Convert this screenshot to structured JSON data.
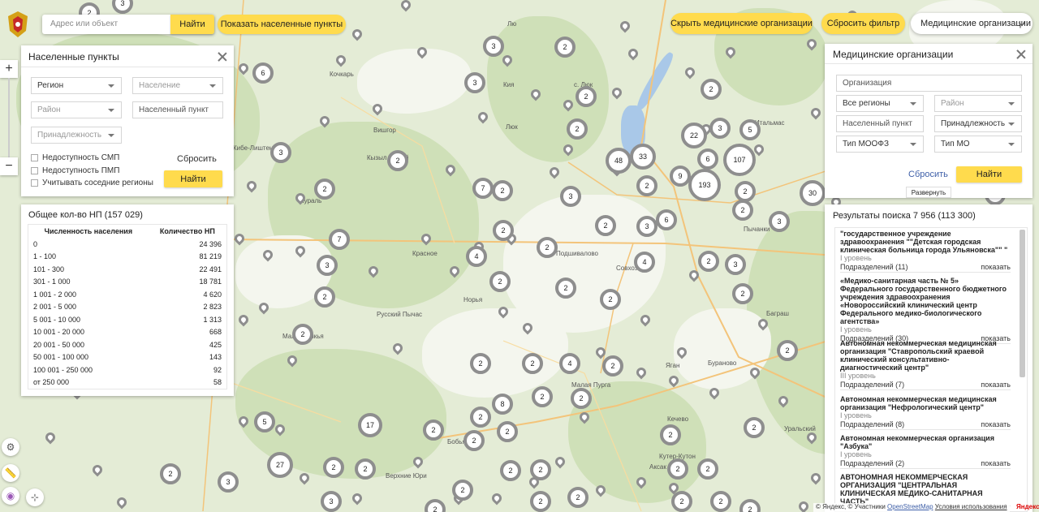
{
  "search": {
    "placeholder": "Адрес или объект",
    "find_label": "Найти",
    "show_settlements_label": "Показать населенные пункты"
  },
  "top_right": {
    "hide_orgs_label": "Скрыть медицинские организации",
    "reset_filter_label": "Сбросить фильтр",
    "layer_select_label": "Медицинские организации"
  },
  "settlements_panel": {
    "title": "Населенные пункты",
    "region": "Регион",
    "population": "Население",
    "district": "Район",
    "settlement": "Населенный пункт",
    "affiliation": "Принадлежность",
    "cb_smp": "Недоступность СМП",
    "cb_pmp": "Недоступность ПМП",
    "cb_neighbors": "Учитывать соседние регионы",
    "reset_label": "Сбросить",
    "find_label": "Найти"
  },
  "stats_panel": {
    "title": "Общее кол-во НП (157 029)",
    "col_population": "Численность населения",
    "col_count": "Количество НП",
    "rows": [
      {
        "range": "0",
        "count": "24 396"
      },
      {
        "range": "1 - 100",
        "count": "81 219"
      },
      {
        "range": "101 - 300",
        "count": "22 491"
      },
      {
        "range": "301 - 1 000",
        "count": "18 781"
      },
      {
        "range": "1 001 - 2 000",
        "count": "4 620"
      },
      {
        "range": "2 001 - 5 000",
        "count": "2 823"
      },
      {
        "range": "5 001 - 10 000",
        "count": "1 313"
      },
      {
        "range": "10 001 - 20 000",
        "count": "668"
      },
      {
        "range": "20 001 - 50 000",
        "count": "425"
      },
      {
        "range": "50 001 - 100 000",
        "count": "143"
      },
      {
        "range": "100 001 - 250 000",
        "count": "92"
      },
      {
        "range": "от 250 000",
        "count": "58"
      }
    ]
  },
  "orgs_panel": {
    "title": "Медицинские организации",
    "organization": "Организация",
    "all_regions": "Все регионы",
    "district": "Район",
    "settlement": "Населенный пункт",
    "affiliation": "Принадлежность",
    "moofz_type": "Тип МООФЗ",
    "mo_type": "Тип МО",
    "reset_label": "Сбросить",
    "find_label": "Найти",
    "expand_label": "Развернуть"
  },
  "results": {
    "title": "Результаты поиска 7 956 (113 300)",
    "show_label": "показать",
    "items": [
      {
        "name": "\"государственное учреждение здравоохранения \"\"Детская городская клиническая больница города Ульяновска\"\" \"",
        "level": "I уровень",
        "sub": "Подразделений (11)"
      },
      {
        "name": "«Медико-санитарная часть № 5» Федерального государственного бюджетного учреждения здравоохранения «Новороссийский клинический центр Федерального медико-биологического агентства»",
        "level": "I уровень",
        "sub": "Подразделений (30)"
      },
      {
        "name": "Автономная некоммерческая медицинская организация \"Ставропольский краевой клинический консультативно-диагностический центр\"",
        "level": "III уровень",
        "sub": "Подразделений (7)"
      },
      {
        "name": "Автономная некоммерческая медицинская организация \"Нефрологический центр\"",
        "level": "I уровень",
        "sub": "Подразделений (8)"
      },
      {
        "name": "Автономная некоммерческая организация \"Азбука\"",
        "level": "I уровень",
        "sub": "Подразделений (2)"
      },
      {
        "name": "АВТОНОМНАЯ НЕКОММЕРЧЕСКАЯ ОРГАНИЗАЦИЯ \"ЦЕНТРАЛЬНАЯ КЛИНИЧЕСКАЯ МЕДИКО-САНИТАРНАЯ ЧАСТЬ\"",
        "level": "",
        "sub": ""
      }
    ]
  },
  "map": {
    "attribution": "© Яндекс, © Участники",
    "osm_link": "OpenStreetMap",
    "terms_link": "Условия использования",
    "yandex_logo": "Яндекс",
    "place_labels": [
      "Кочкарь",
      "Вишгор",
      "Кызыл Новый",
      "Лю",
      "Кия",
      "с. Люк",
      "Люк",
      "Кураль",
      "Кибе-Лиштень",
      "Подшивалово",
      "Красное",
      "Русский Пычас",
      "Норья",
      "Совхозный",
      "Малая Пурга",
      "Бобья-Учка",
      "Верхние Юри",
      "Кутер-Кутон",
      "Кечево",
      "Аксак",
      "Уральский",
      "Итальмас",
      "Пычанки",
      "Баграш",
      "Яган",
      "Бураново",
      "Паймаш",
      "Маловожикья"
    ],
    "clusters": [
      "2",
      "3",
      "2",
      "3",
      "6",
      "3",
      "2",
      "2",
      "2",
      "5",
      "22",
      "3",
      "6",
      "107",
      "9",
      "193",
      "48",
      "2",
      "33",
      "2",
      "2",
      "30",
      "3",
      "2",
      "3",
      "2",
      "7",
      "2",
      "3",
      "7",
      "2",
      "3",
      "6",
      "4",
      "2",
      "4",
      "2",
      "2",
      "3",
      "2",
      "2",
      "2",
      "2",
      "3",
      "2",
      "2",
      "2",
      "2",
      "4",
      "2",
      "2",
      "2",
      "8",
      "2",
      "2",
      "2",
      "2",
      "17",
      "5",
      "2",
      "2",
      "2",
      "27",
      "2",
      "2",
      "2",
      "3",
      "2",
      "2",
      "2",
      "3",
      "2",
      "2",
      "2",
      "2",
      "2",
      "2",
      "2",
      "2",
      "2"
    ]
  }
}
